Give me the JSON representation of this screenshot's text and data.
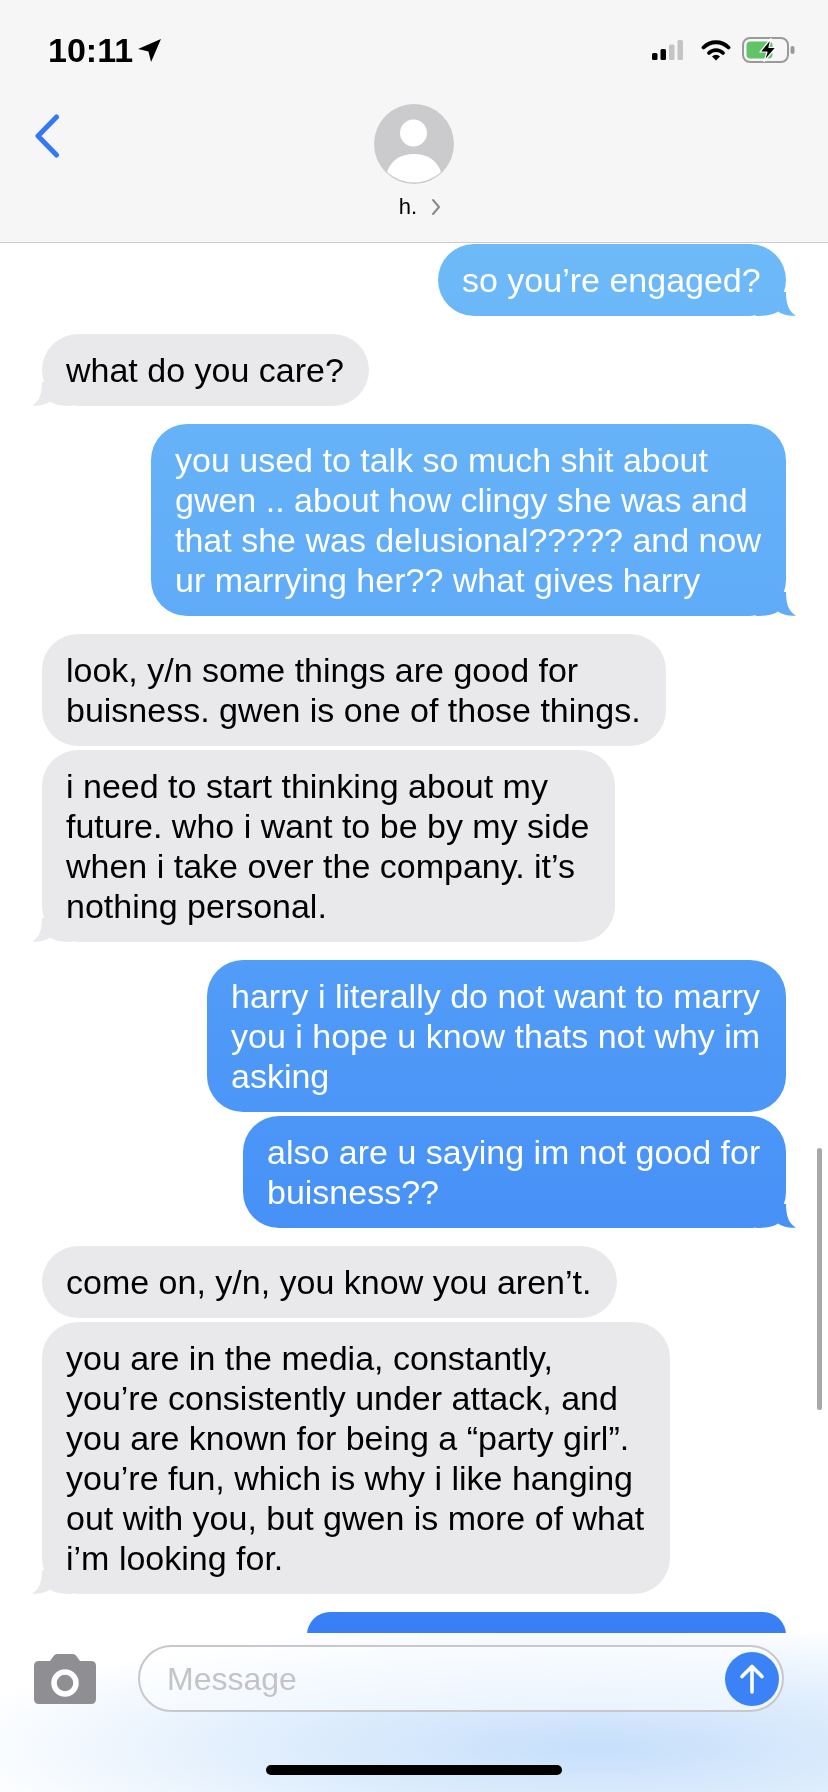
{
  "status_bar": {
    "time": "10:11"
  },
  "header": {
    "contact_name": "h."
  },
  "messages": [
    {
      "kind": "message",
      "outgoing": true,
      "text": "so you’re engaged?",
      "tail": true
    },
    {
      "kind": "message",
      "outgoing": false,
      "text": "what do you care?",
      "tail": true
    },
    {
      "kind": "message",
      "outgoing": true,
      "text": "you used to talk so much shit about gwen .. about how clingy she was and that she was delusional????? and now ur marrying her?? what gives harry",
      "tail": true
    },
    {
      "kind": "message",
      "outgoing": false,
      "text": "look, y/n some things are good for buisness. gwen is one of those things.",
      "tail": false
    },
    {
      "kind": "message",
      "outgoing": false,
      "text": "i need to start thinking about my future. who i want to be by my side when i take over the company. it’s nothing personal.",
      "tail": true
    },
    {
      "kind": "message",
      "outgoing": true,
      "text": "harry i literally do not want to marry you i hope u know thats not why im asking",
      "tail": false
    },
    {
      "kind": "message",
      "outgoing": true,
      "text": "also are u saying im not good for buisness??",
      "tail": true
    },
    {
      "kind": "message",
      "outgoing": false,
      "text": "come on, y/n, you know you aren’t.",
      "tail": false
    },
    {
      "kind": "message",
      "outgoing": false,
      "text": "you are in the media, constantly, you’re consistently under attack, and you are known for being a “party girl”. you’re fun, which is why i like hanging out with you, but gwen is more of what i’m looking for.",
      "tail": true
    },
    {
      "kind": "cut_off",
      "outgoing": true
    }
  ],
  "composer": {
    "placeholder": "Message"
  }
}
